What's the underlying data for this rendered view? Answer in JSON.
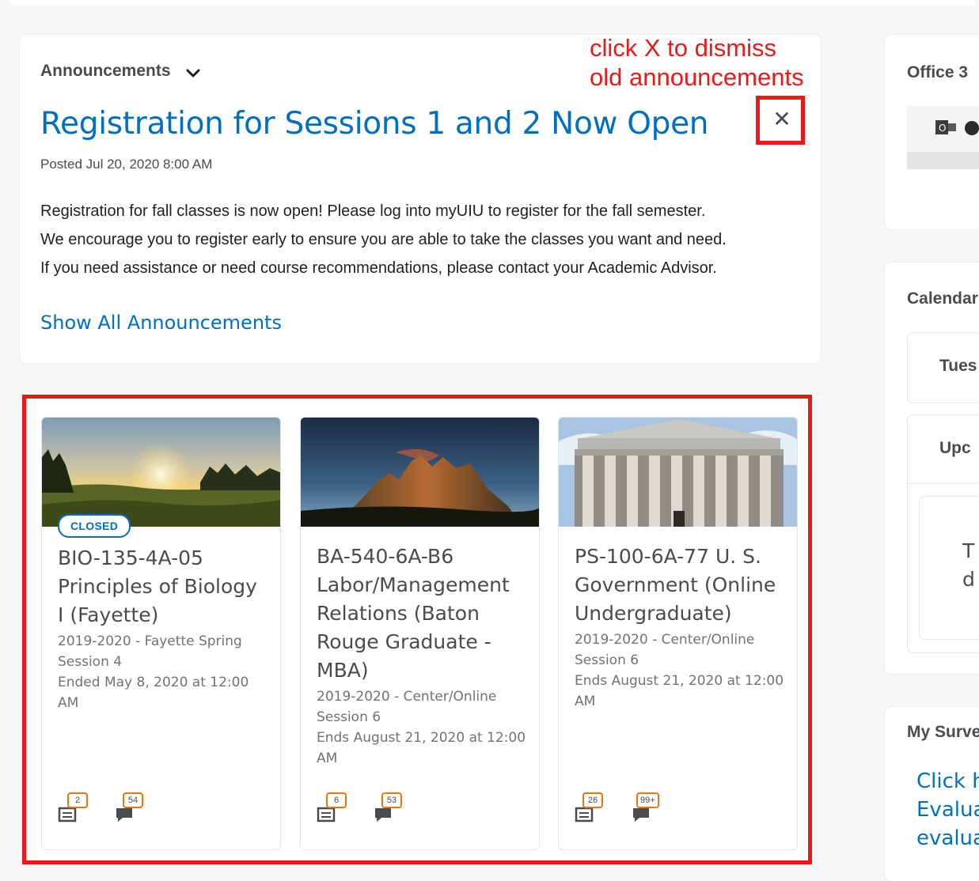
{
  "annotation_note": [
    "click X to dismiss",
    "old announcements"
  ],
  "announcements": {
    "widget_title": "Announcements",
    "title": "Registration for Sessions 1 and 2 Now Open",
    "posted": "Posted Jul 20, 2020 8:00 AM",
    "body_lines": [
      "Registration for fall classes is now open! Please log into myUIU to register for the fall semester.",
      "We encourage you to register early to ensure you are able to take the classes you want and need.",
      "If you need assistance or need course recommendations, please contact your Academic Advisor."
    ],
    "show_all": "Show All Announcements",
    "dismiss_glyph": "✕"
  },
  "courses": [
    {
      "badge": "CLOSED",
      "name": "BIO-135-4A-05 Principles of Biology I (Fayette)",
      "term": "2019-2020 - Fayette Spring Session 4",
      "dates": "Ended May 8, 2020 at 12:00 AM",
      "assignments_count": "2",
      "discussions_count": "54"
    },
    {
      "badge": "",
      "name": "BA-540-6A-B6 Labor/Management Relations (Baton Rouge Graduate - MBA)",
      "term": "2019-2020 - Center/Online Session 6",
      "dates": "Ends August 21, 2020 at 12:00 AM",
      "assignments_count": "6",
      "discussions_count": "53"
    },
    {
      "badge": "",
      "name": "PS-100-6A-77 U. S. Government (Online Undergraduate)",
      "term": "2019-2020 - Center/Online Session 6",
      "dates": "Ends August 21, 2020 at 12:00 AM",
      "assignments_count": "26",
      "discussions_count": "99+"
    }
  ],
  "right_panel": {
    "office_title": "Office 3",
    "calendar_title": "Calendar",
    "calendar_day": "Tues",
    "calendar_upcoming": "Upc",
    "calendar_empty_1": "T",
    "calendar_empty_2": "d",
    "surveys_title": "My Surve",
    "surveys_link_lines": [
      "Click h",
      "Evalua",
      "evalua"
    ]
  },
  "colors": {
    "link": "#006fbf",
    "annotation_red": "#e81a1a",
    "badge_orange": "#e87511"
  }
}
